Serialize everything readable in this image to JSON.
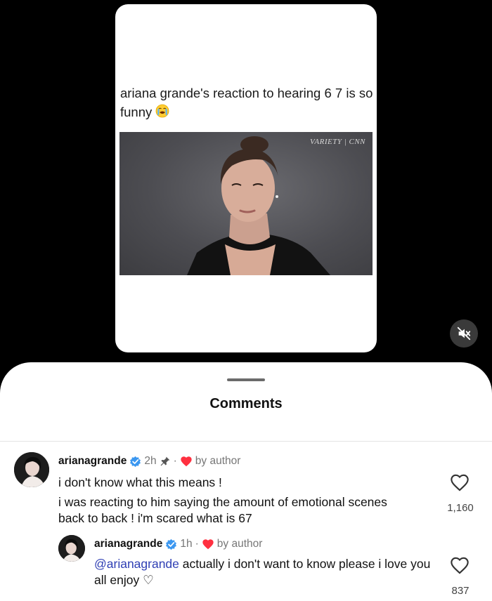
{
  "post": {
    "caption": "ariana grande's reaction to hearing 6 7 is so funny",
    "caption_emoji": "loudly-crying-face",
    "watermark": "VARIETY | CNN"
  },
  "video": {
    "mute_icon": "speaker-muted-icon"
  },
  "comments_sheet": {
    "title": "Comments",
    "comments": [
      {
        "username": "arianagrande",
        "verified": true,
        "time": "2h",
        "pinned": true,
        "separator": "·",
        "liked_by_author": "by author",
        "text_1": "i don't know what this means !",
        "text_2": "i was reacting to him saying the amount of emotional scenes back to back ! i'm scared what is 67",
        "likes": "1,160"
      },
      {
        "username": "arianagrande",
        "verified": true,
        "time": "1h",
        "separator": "·",
        "liked_by_author": "by author",
        "mention": "@arianagrande",
        "text": " actually i don't want to know please i love you all enjoy ♡",
        "likes": "837"
      }
    ]
  },
  "colors": {
    "verified_blue": "#3b97f0",
    "heart_red": "#ff3040",
    "mention_blue": "#2f3fb4"
  }
}
